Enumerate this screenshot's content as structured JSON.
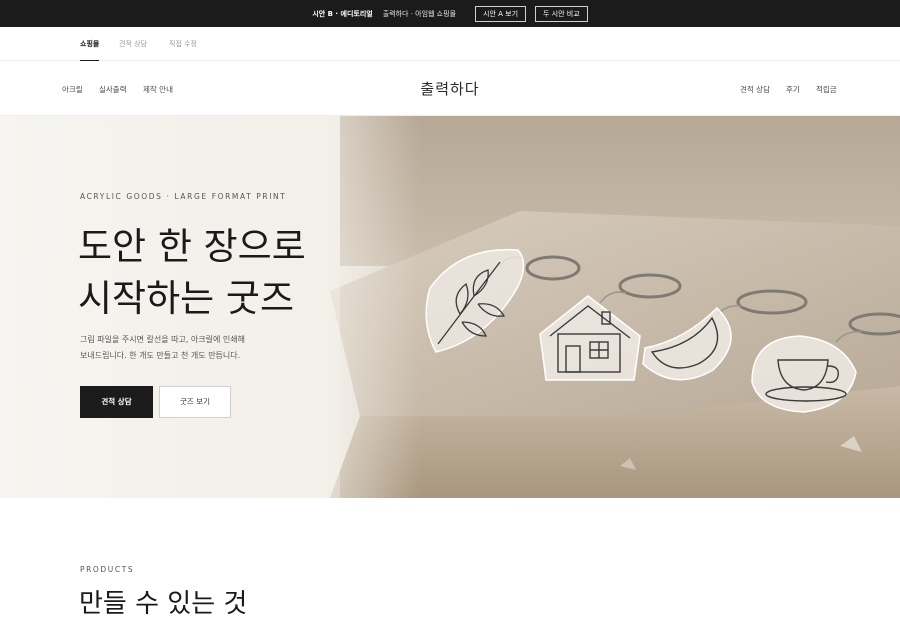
{
  "topbar": {
    "variant_label": "시안 B · 에디토리얼",
    "site_text": "출력하다 · 아임웹 쇼핑몰",
    "view_a_button": "시안 A 보기",
    "compare_button": "두 시안 비교"
  },
  "tabs": [
    {
      "label": "쇼핑몰"
    },
    {
      "label": "견적 상담"
    },
    {
      "label": "직접 수정"
    }
  ],
  "nav": {
    "logo": "출력하다",
    "left": [
      {
        "label": "아크릴"
      },
      {
        "label": "실사출력"
      },
      {
        "label": "제작 안내"
      }
    ],
    "right": [
      {
        "label": "견적 상담"
      },
      {
        "label": "후기"
      },
      {
        "label": "적립금"
      }
    ]
  },
  "hero": {
    "eyebrow": "ACRYLIC GOODS · LARGE FORMAT PRINT",
    "headline_line1": "도안 한 장으로",
    "headline_line2": "시작하는 굿즈",
    "desc_line1": "그림 파일을 주시면 칼선을 따고, 아크릴에 인쇄해",
    "desc_line2": "보내드립니다. 한 개도 만들고 천 개도 만듭니다.",
    "primary_button": "견적 상담",
    "secondary_button": "굿즈 보기"
  },
  "products": {
    "eyebrow": "PRODUCTS",
    "title": "만들 수 있는 것"
  },
  "colors": {
    "dark": "#1b1b1b",
    "hero_light": "#f4f1ec",
    "stone": "#b9a994"
  }
}
